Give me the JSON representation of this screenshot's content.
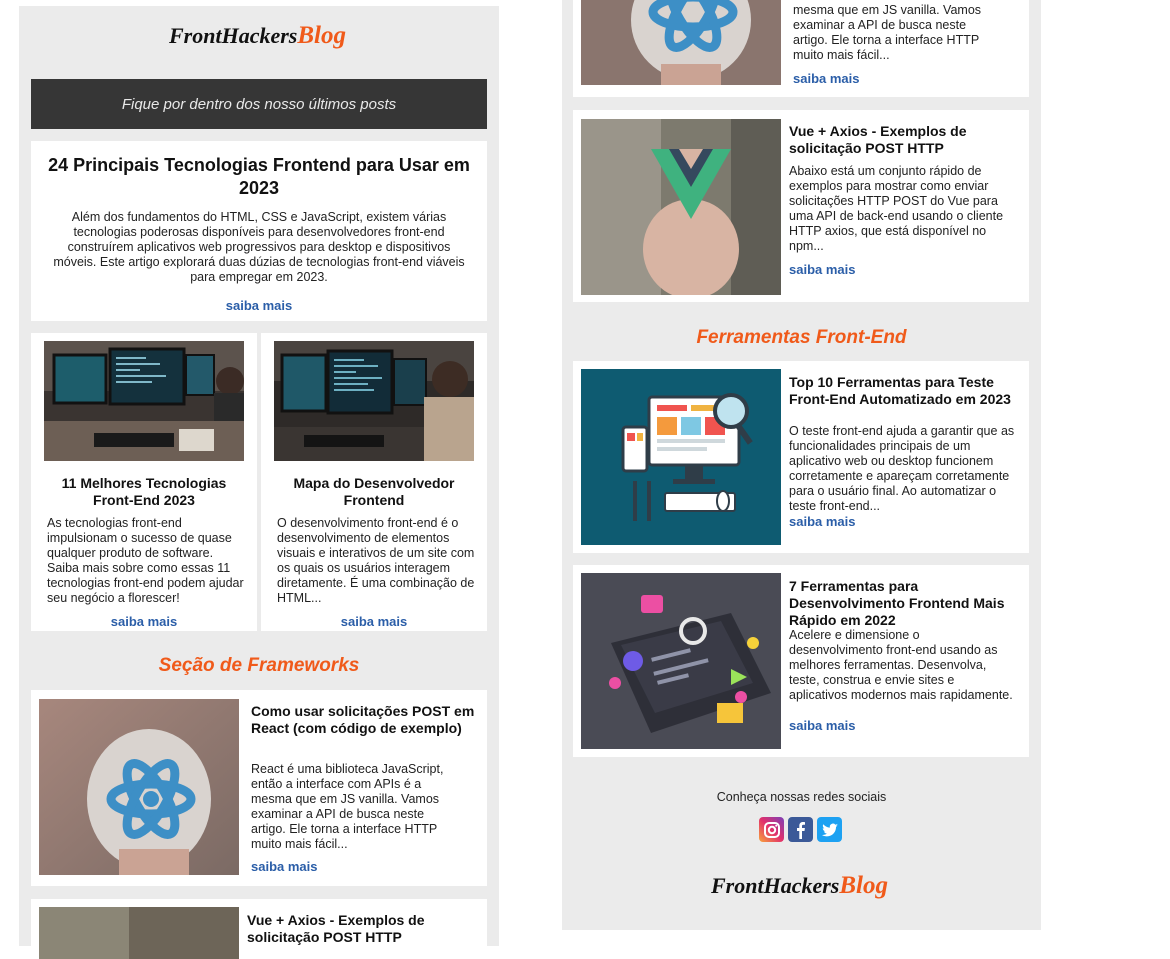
{
  "brand": {
    "name": "FrontHackers",
    "accent": "Blog"
  },
  "banner": {
    "text": "Fique por dentro dos nosso últimos posts"
  },
  "featured": {
    "title": "24 Principais Tecnologias Frontend para Usar em 2023",
    "excerpt": "Além dos fundamentos do HTML, CSS e JavaScript, existem várias tecnologias poderosas disponíveis para desenvolvedores front-end construírem aplicativos web progressivos para desktop e dispositivos móveis. Este artigo explorará duas dúzias de tecnologias front-end viáveis para empregar em 2023.",
    "more": "saiba mais"
  },
  "grid": [
    {
      "title": "11 Melhores Tecnologias Front-End 2023",
      "excerpt": "As tecnologias front-end impulsionam o sucesso de quase qualquer produto de software. Saiba mais sobre como essas 11 tecnologias front-end podem ajudar seu negócio a florescer!",
      "more": "saiba mais"
    },
    {
      "title": "Mapa do Desenvolvedor Frontend",
      "excerpt": "O desenvolvimento front-end é o desenvolvimento de elementos visuais e interativos de um site com os quais os usuários interagem diretamente. É uma combinação de HTML...",
      "more": "saiba mais"
    }
  ],
  "frameworks": {
    "title": "Seção de Frameworks",
    "items": [
      {
        "title": "Como usar solicitações POST em React (com código de exemplo)",
        "excerpt": "React é uma biblioteca JavaScript, então a interface com APIs é a mesma que em JS vanilla. Vamos examinar a API de busca neste artigo. Ele torna a interface HTTP muito mais fácil...",
        "more": "saiba mais"
      },
      {
        "title": "Vue + Axios - Exemplos de solicitação POST HTTP",
        "excerpt": "Abaixo está um conjunto rápido de exemplos para mostrar como enviar solicitações HTTP POST do Vue para uma API de back-end usando o cliente HTTP axios, que está disponível no npm...",
        "more": "saiba mais"
      }
    ]
  },
  "tools": {
    "title": "Ferramentas Front-End",
    "items": [
      {
        "title": "Top 10 Ferramentas para Teste Front-End Automatizado em 2023",
        "excerpt": "O teste front-end ajuda a garantir que as funcionalidades principais de um aplicativo web ou desktop funcionem corretamente e apareçam corretamente para o usuário final. Ao automatizar o teste front-end...",
        "more": "saiba mais"
      },
      {
        "title": "7 Ferramentas para Desenvolvimento Frontend Mais Rápido em 2022",
        "excerpt": "Acelere e dimensione o desenvolvimento front-end usando as melhores ferramentas. Desenvolva, teste, construa e envie sites e aplicativos modernos mais rapidamente.",
        "more": "saiba mais"
      }
    ]
  },
  "right_top_partial": {
    "excerpt_tail": "mesma que em JS vanilla. Vamos examinar a API de busca neste artigo. Ele torna a interface HTTP muito mais fácil...",
    "more": "saiba mais"
  },
  "footer": {
    "social_label": "Conheça nossas redes sociais",
    "icons": [
      "instagram-icon",
      "facebook-icon",
      "twitter-icon"
    ]
  },
  "colors": {
    "accent": "#f05a1a",
    "link": "#2b5ea8",
    "banner": "#363636",
    "column_bg": "#ebebeb"
  }
}
